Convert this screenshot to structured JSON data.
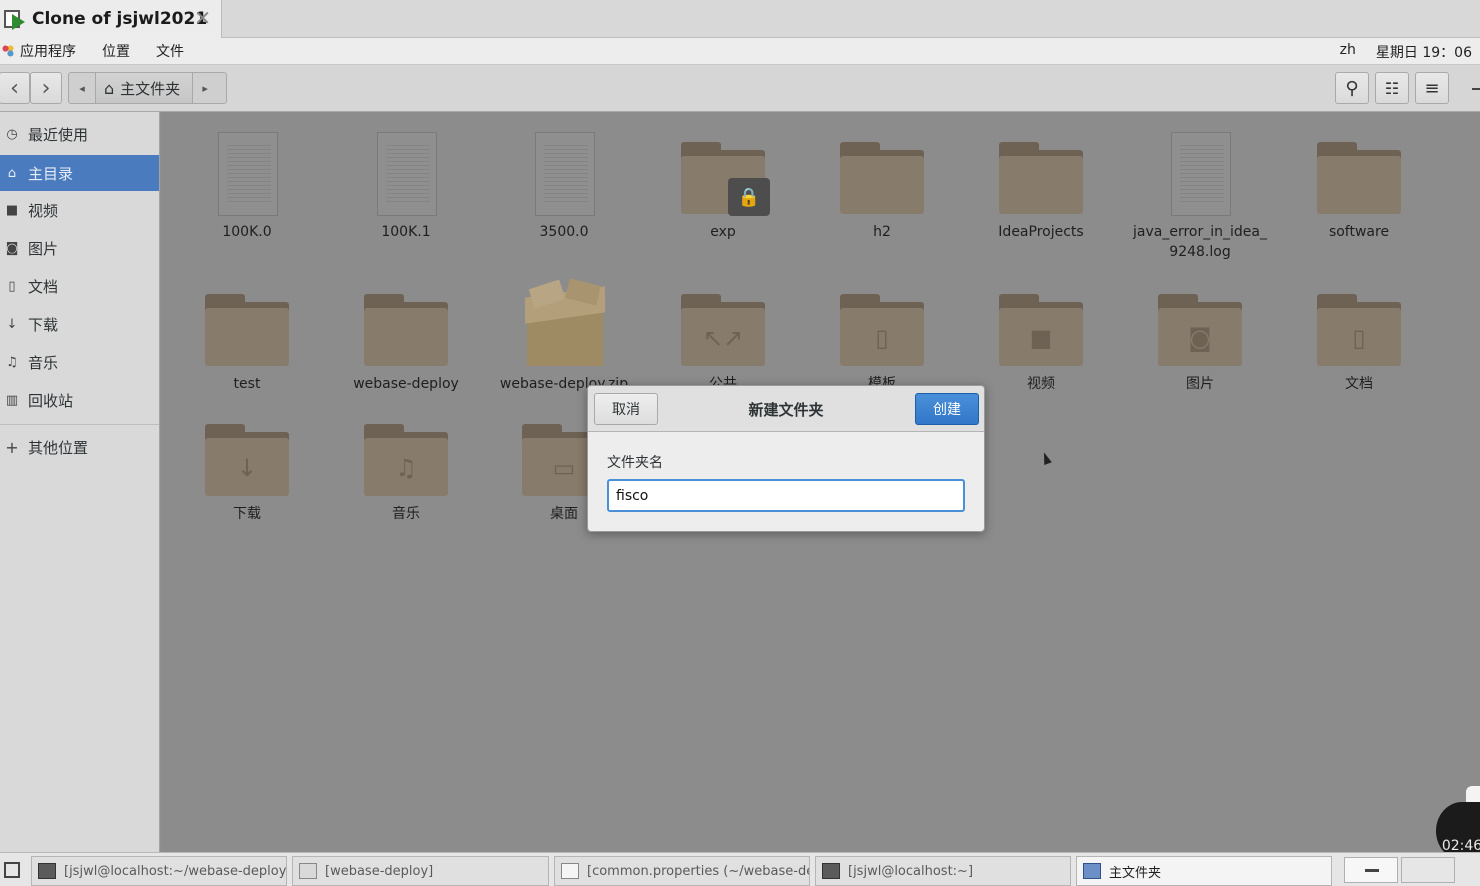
{
  "vm_tab": {
    "title": "Clone of jsjwl2021",
    "close_glyph": "✕"
  },
  "topbar": {
    "menus": [
      "应用程序",
      "位置",
      "文件"
    ],
    "input_method": "zh",
    "clock": "星期日 19：06"
  },
  "headerbar": {
    "back_glyph": "‹",
    "forward_glyph": "›",
    "path_left_glyph": "◂",
    "path_right_glyph": "▸",
    "location_label": "主文件夹",
    "home_glyph": "⌂",
    "search_glyph": "⚲",
    "view_glyph": "☷",
    "menu_glyph": "≡"
  },
  "sidebar": {
    "items": [
      {
        "label": "最近使用",
        "icon": "clock-icon",
        "glyph": "◷"
      },
      {
        "label": "主目录",
        "icon": "home-icon",
        "glyph": "⌂"
      },
      {
        "label": "视频",
        "icon": "video-icon",
        "glyph": "■"
      },
      {
        "label": "图片",
        "icon": "camera-icon",
        "glyph": "◙"
      },
      {
        "label": "文档",
        "icon": "document-icon",
        "glyph": "▯"
      },
      {
        "label": "下载",
        "icon": "download-icon",
        "glyph": "↓"
      },
      {
        "label": "音乐",
        "icon": "music-icon",
        "glyph": "♫"
      },
      {
        "label": "回收站",
        "icon": "trash-icon",
        "glyph": "▥"
      },
      {
        "label": "其他位置",
        "icon": "plus-icon",
        "glyph": "+"
      }
    ]
  },
  "files": [
    {
      "name": "100K.0",
      "kind": "document"
    },
    {
      "name": "100K.1",
      "kind": "document"
    },
    {
      "name": "3500.0",
      "kind": "document"
    },
    {
      "name": "exp",
      "kind": "folder-locked"
    },
    {
      "name": "h2",
      "kind": "folder"
    },
    {
      "name": "IdeaProjects",
      "kind": "folder"
    },
    {
      "name": "java_error_in_idea_",
      "name_line2": "9248.log",
      "kind": "document"
    },
    {
      "name": "software",
      "kind": "folder"
    },
    {
      "name": "test",
      "kind": "folder"
    },
    {
      "name": "webase-deploy",
      "kind": "folder"
    },
    {
      "name": "webase-deploy.zip",
      "kind": "archive"
    },
    {
      "name": "公共",
      "kind": "folder",
      "emblem": "↖↗"
    },
    {
      "name": "模板",
      "kind": "folder",
      "emblem": "▯"
    },
    {
      "name": "视频",
      "kind": "folder",
      "emblem": "■"
    },
    {
      "name": "图片",
      "kind": "folder",
      "emblem": "◙"
    },
    {
      "name": "文档",
      "kind": "folder",
      "emblem": "▯"
    },
    {
      "name": "下载",
      "kind": "folder",
      "emblem": "↓"
    },
    {
      "name": "音乐",
      "kind": "folder",
      "emblem": "♫"
    },
    {
      "name": "桌面",
      "kind": "folder",
      "emblem": "▭"
    }
  ],
  "dialog": {
    "title": "新建文件夹",
    "cancel_label": "取消",
    "create_label": "创建",
    "field_label": "文件夹名",
    "field_value": "fisco"
  },
  "clock_widget": {
    "time": "02:46"
  },
  "taskbar": {
    "tasks": [
      {
        "label": "[jsjwl@localhost:~/webase-deploy]",
        "icon": "terminal-icon"
      },
      {
        "label": "[webase-deploy]",
        "icon": "files-icon"
      },
      {
        "label": "[common.properties (~/webase-de…",
        "icon": "text-editor-icon"
      },
      {
        "label": "[jsjwl@localhost:~]",
        "icon": "terminal-icon"
      },
      {
        "label": "主文件夹",
        "icon": "files-icon"
      }
    ]
  },
  "colors": {
    "accent": "#4a7bbf",
    "create_button": "#3277c9",
    "focus_border": "#4a90d9",
    "folder": "#877b6b"
  }
}
